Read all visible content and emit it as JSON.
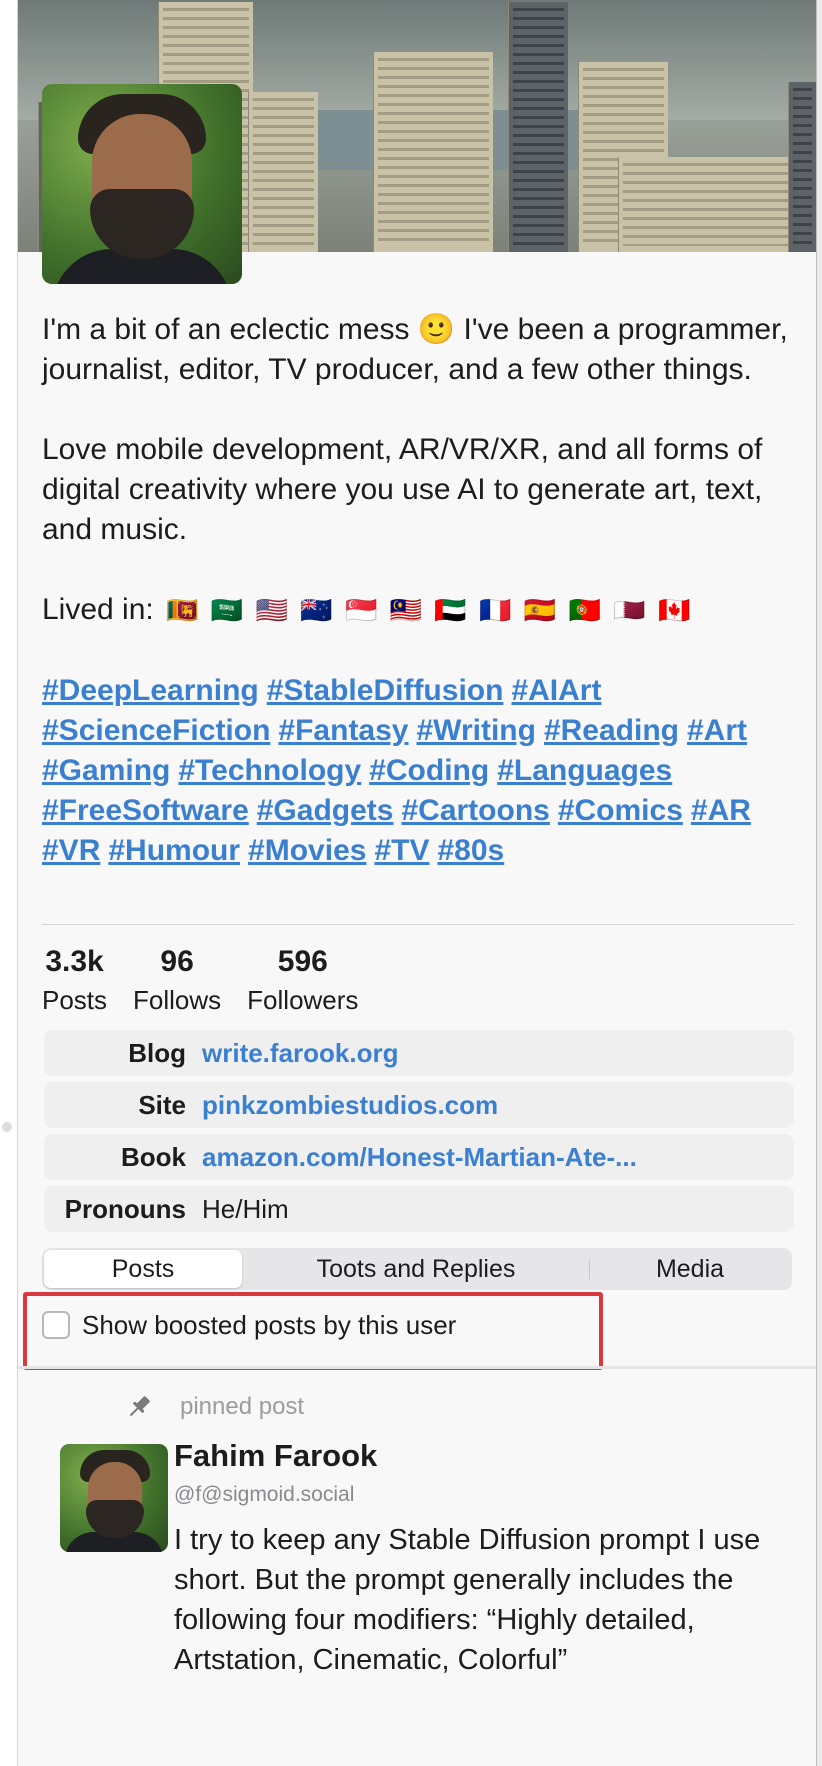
{
  "profile": {
    "bio_line1": "I'm a bit of an eclectic mess 🙂 I've been a programmer, journalist, editor, TV producer, and a few other things.",
    "bio_line2": "Love mobile development, AR/VR/XR, and all forms of digital creativity where you use AI to generate art, text, and music.",
    "lived_in_label": "Lived in:",
    "flags": [
      "🇱🇰",
      "🇸🇦",
      "🇺🇸",
      "🇳🇿",
      "🇸🇬",
      "🇲🇾",
      "🇦🇪",
      "🇫🇷",
      "🇪🇸",
      "🇵🇹",
      "🇶🇦",
      "🇨🇦"
    ],
    "hashtags": [
      "#DeepLearning",
      "#StableDiffusion",
      "#AIArt",
      "#ScienceFiction",
      "#Fantasy",
      "#Writing",
      "#Reading",
      "#Art",
      "#Gaming",
      "#Technology",
      "#Coding",
      "#Languages",
      "#FreeSoftware",
      "#Gadgets",
      "#Cartoons",
      "#Comics",
      "#AR",
      "#VR",
      "#Humour",
      "#Movies",
      "#TV",
      "#80s"
    ]
  },
  "stats": [
    {
      "value": "3.3k",
      "label": "Posts"
    },
    {
      "value": "96",
      "label": "Follows"
    },
    {
      "value": "596",
      "label": "Followers"
    }
  ],
  "fields": [
    {
      "name": "Blog",
      "value": "write.farook.org",
      "link": true
    },
    {
      "name": "Site",
      "value": "pinkzombiestudios.com",
      "link": true
    },
    {
      "name": "Book",
      "value": "amazon.com/Honest-Martian-Ate-...",
      "link": true
    },
    {
      "name": "Pronouns",
      "value": "He/Him",
      "link": false
    }
  ],
  "tabs": [
    {
      "label": "Posts",
      "selected": true
    },
    {
      "label": "Toots and Replies",
      "selected": false
    },
    {
      "label": "Media",
      "selected": false
    }
  ],
  "filter": {
    "label": "Show boosted posts by this user",
    "checked": false
  },
  "post": {
    "pinned_label": "pinned post",
    "author": "Fahim Farook",
    "handle": "@f@sigmoid.social",
    "content": "I try to keep any Stable Diffusion prompt I use short. But the prompt generally includes the following four modifiers: “Highly detailed, Artstation, Cinematic, Colorful”"
  },
  "colors": {
    "link": "#3a7fd0",
    "highlight_border": "#d93a3f",
    "background": "#f8f8f8"
  },
  "icons": [
    "pin-icon"
  ]
}
